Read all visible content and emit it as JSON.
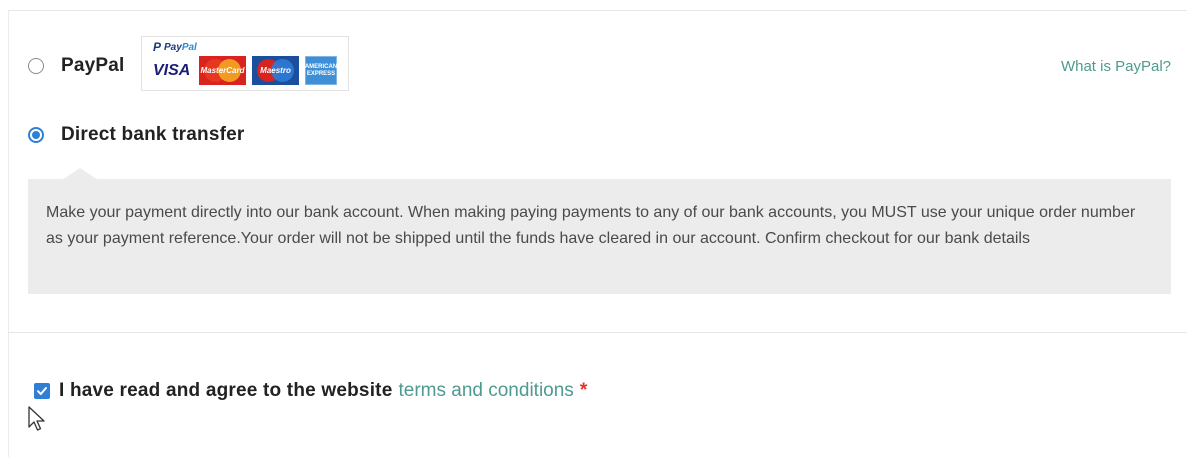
{
  "payment": {
    "paypal": {
      "label": "PayPal",
      "selected": false,
      "logo_text_pay": "Pay",
      "logo_text_pal": "Pal",
      "logo_glyph": "P",
      "cards": {
        "visa": "VISA",
        "mastercard": "MasterCard",
        "maestro": "Maestro",
        "amex_line1": "AMERICAN",
        "amex_line2": "EXPRESS"
      },
      "what_is_link": "What is PayPal?"
    },
    "bank": {
      "label": "Direct bank transfer",
      "selected": true,
      "description": "Make your payment directly into our bank account. When making paying payments to any of our bank accounts, you MUST use your unique order number as your payment reference.Your order will not be shipped until the funds have cleared in our account. Confirm checkout for our bank details"
    }
  },
  "agreement": {
    "checked": true,
    "text": "I have read and agree to the website",
    "link_text": "terms and conditions",
    "required_mark": "*"
  },
  "colors": {
    "accent": "#2f7fd6",
    "link": "#4f9a8e",
    "required": "#e0342b",
    "panel": "#ececec"
  }
}
